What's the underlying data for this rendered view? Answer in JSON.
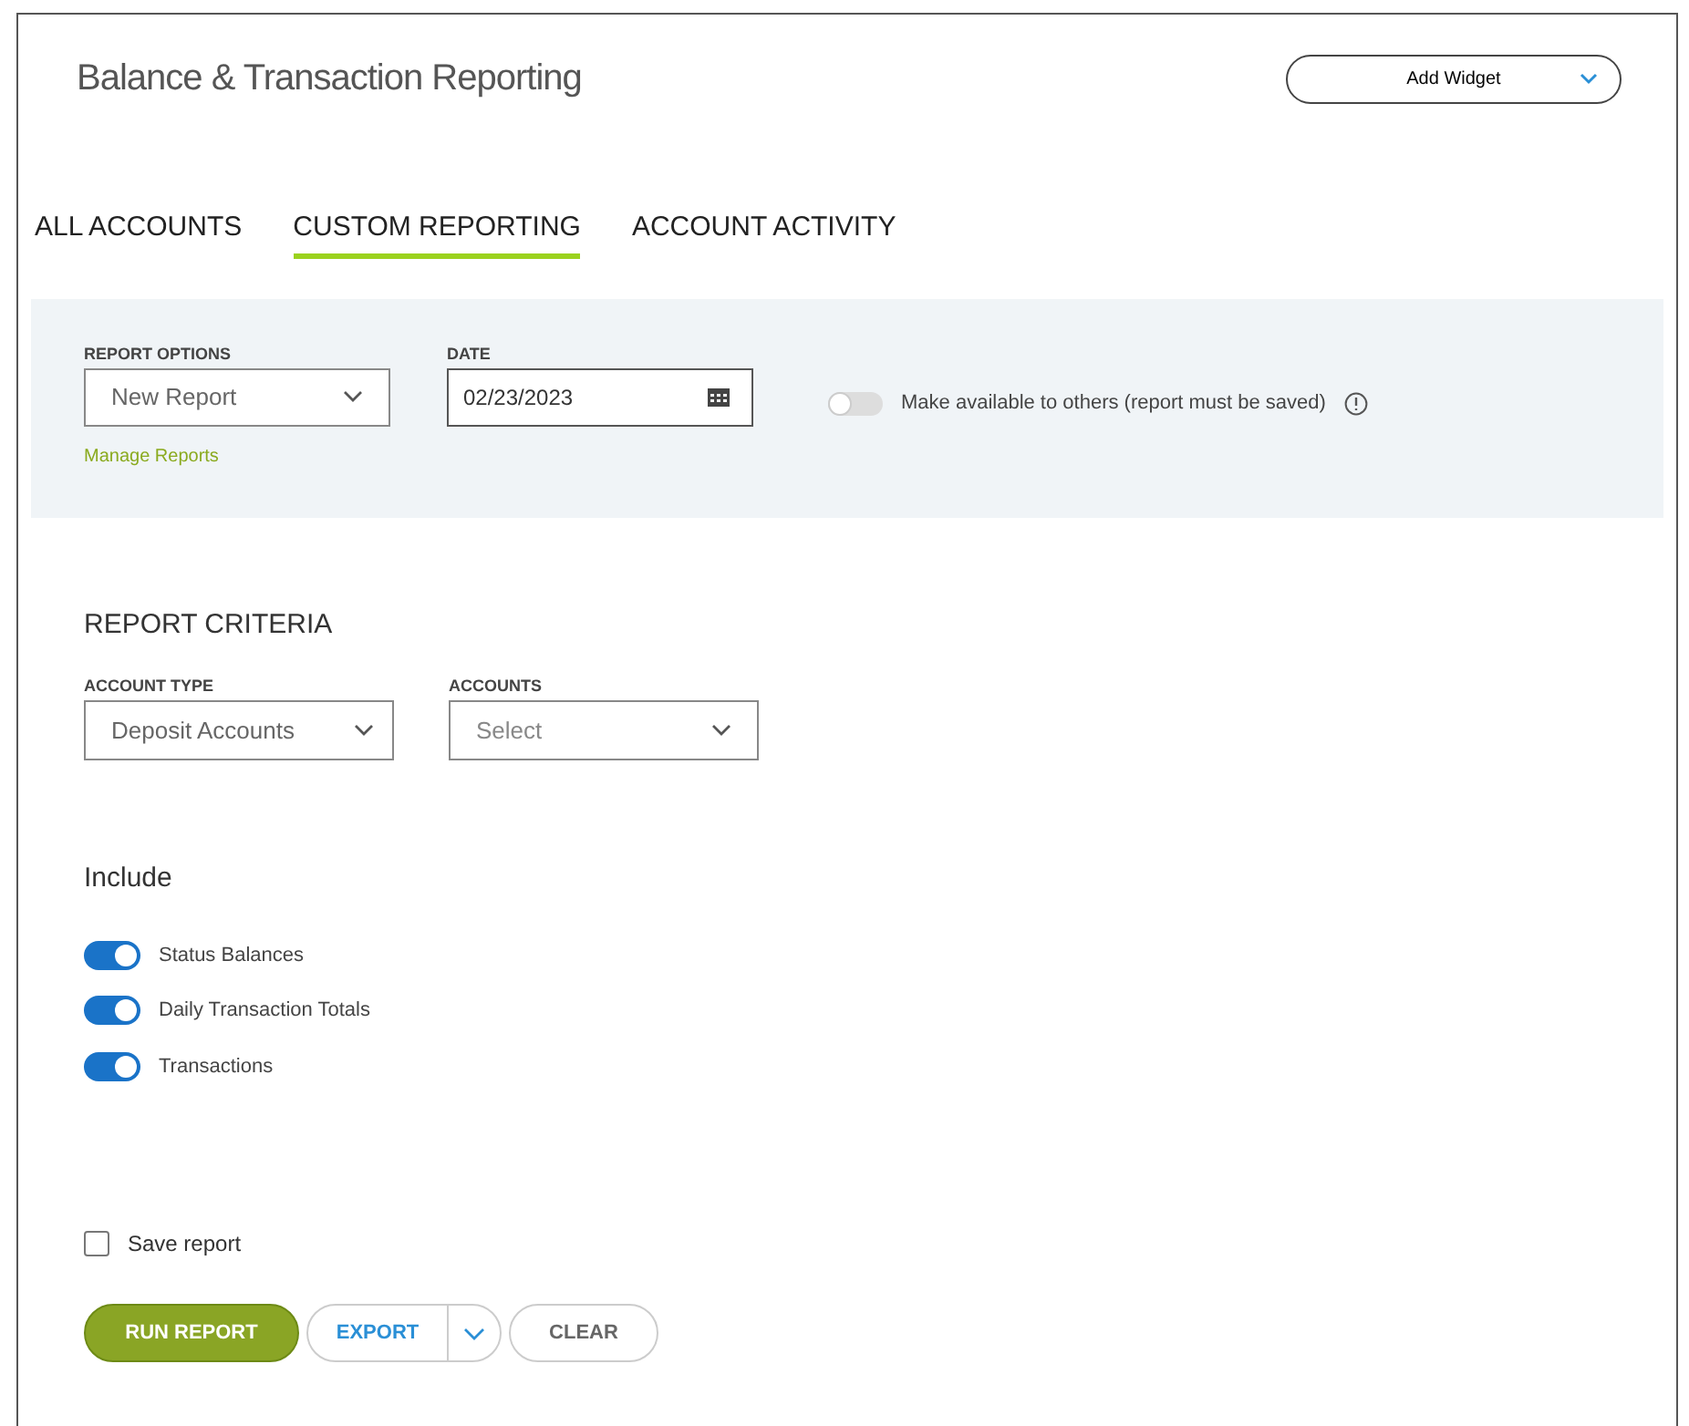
{
  "header": {
    "title": "Balance & Transaction Reporting",
    "add_widget": "Add Widget"
  },
  "tabs": [
    {
      "label": "ALL ACCOUNTS",
      "selected": false
    },
    {
      "label": "CUSTOM REPORTING",
      "selected": true
    },
    {
      "label": "ACCOUNT ACTIVITY",
      "selected": false
    }
  ],
  "options_panel": {
    "report_options": {
      "label": "REPORT OPTIONS",
      "value": "New Report"
    },
    "date": {
      "label": "DATE",
      "value": "02/23/2023"
    },
    "share": {
      "label": "Make available to others (report must be saved)",
      "on": false
    },
    "manage_link": "Manage Reports"
  },
  "criteria": {
    "heading": "REPORT CRITERIA",
    "account_type": {
      "label": "ACCOUNT TYPE",
      "value": "Deposit Accounts"
    },
    "accounts": {
      "label": "ACCOUNTS",
      "placeholder": "Select"
    }
  },
  "include": {
    "heading": "Include",
    "items": [
      {
        "label": "Status Balances",
        "on": true
      },
      {
        "label": "Daily Transaction Totals",
        "on": true
      },
      {
        "label": "Transactions",
        "on": true
      }
    ]
  },
  "save_report": {
    "label": "Save report",
    "checked": false
  },
  "buttons": {
    "run": "RUN REPORT",
    "export": "EXPORT",
    "clear": "CLEAR"
  }
}
